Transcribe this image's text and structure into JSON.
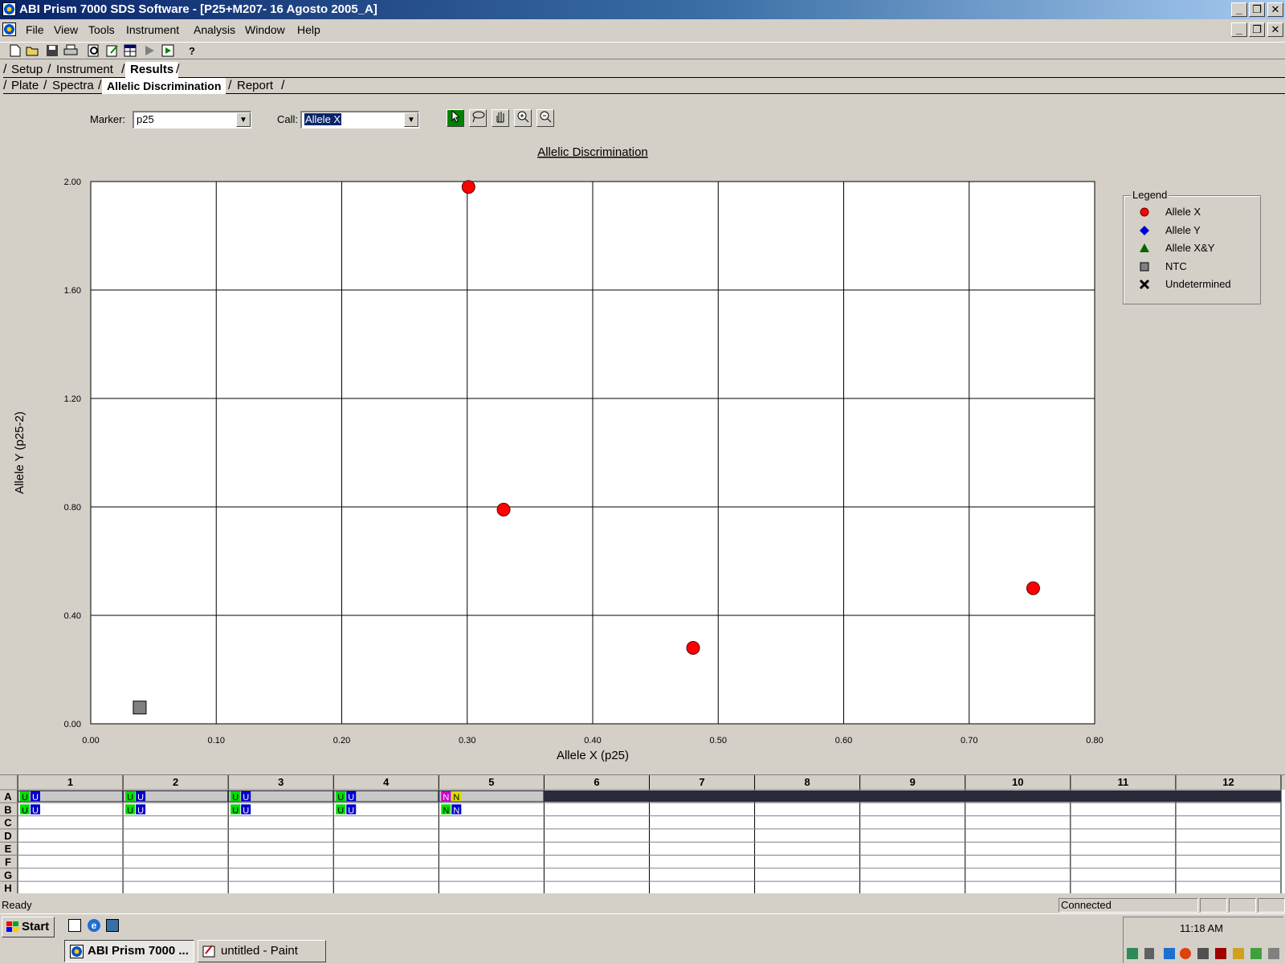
{
  "window": {
    "title": "ABI Prism 7000 SDS Software - [P25+M207- 16 Agosto 2005_A]",
    "minimize": "_",
    "restore": "❐",
    "close": "✕"
  },
  "menu": [
    "File",
    "View",
    "Tools",
    "Instrument",
    "Analysis",
    "Window",
    "Help"
  ],
  "toolbar": {
    "icons": [
      "new-icon",
      "open-icon",
      "save-icon",
      "print-icon",
      "preview-icon",
      "edit-icon",
      "table-icon",
      "play-icon",
      "run-icon",
      "help-icon"
    ]
  },
  "tabs": {
    "main": [
      "Setup",
      "Instrument",
      "Results"
    ],
    "main_active": "Results",
    "sub": [
      "Plate",
      "Spectra",
      "Allelic Discrimination",
      "Report"
    ],
    "sub_active": "Allelic Discrimination"
  },
  "controls": {
    "marker_label": "Marker:",
    "marker_value": "p25",
    "call_label": "Call:",
    "call_value": "Allele X",
    "tools": [
      "select-tool-icon",
      "lasso-tool-icon",
      "pan-tool-icon",
      "zoom-in-icon",
      "zoom-out-icon"
    ]
  },
  "chart_data": {
    "type": "scatter",
    "title": "Allelic Discrimination",
    "xlabel": "Allele X (p25)",
    "ylabel": "Allele Y (p25-2)",
    "xlim": [
      0.0,
      0.8
    ],
    "ylim": [
      0.0,
      2.0
    ],
    "xticks": [
      "0.00",
      "0.10",
      "0.20",
      "0.30",
      "0.40",
      "0.50",
      "0.60",
      "0.70",
      "0.80"
    ],
    "yticks": [
      "0.00",
      "0.40",
      "0.80",
      "1.20",
      "1.60",
      "2.00"
    ],
    "grid": true,
    "legend_position": "right",
    "series": [
      {
        "name": "Allele X",
        "marker": "circle",
        "color": "#ff0000",
        "points": [
          [
            0.301,
            1.98
          ],
          [
            0.329,
            0.79
          ],
          [
            0.48,
            0.28
          ],
          [
            0.751,
            0.5
          ]
        ]
      },
      {
        "name": "Allele Y",
        "marker": "diamond",
        "color": "#0000cc",
        "points": []
      },
      {
        "name": "Allele X&Y",
        "marker": "triangle",
        "color": "#006600",
        "points": []
      },
      {
        "name": "NTC",
        "marker": "square",
        "color": "#808080",
        "points": [
          [
            0.039,
            0.06
          ]
        ]
      },
      {
        "name": "Undetermined",
        "marker": "x",
        "color": "#000000",
        "points": []
      }
    ]
  },
  "legend": {
    "title": "Legend",
    "items": [
      {
        "label": "Allele X",
        "marker": "circle",
        "color": "#ff0000"
      },
      {
        "label": "Allele Y",
        "marker": "diamond",
        "color": "#0000cc"
      },
      {
        "label": "Allele X&Y",
        "marker": "triangle",
        "color": "#006600"
      },
      {
        "label": "NTC",
        "marker": "square",
        "color": "#808080"
      },
      {
        "label": "Undetermined",
        "marker": "x",
        "color": "#000000"
      }
    ]
  },
  "plate": {
    "columns": [
      "1",
      "2",
      "3",
      "4",
      "5",
      "6",
      "7",
      "8",
      "9",
      "10",
      "11",
      "12"
    ],
    "rows": [
      "A",
      "B",
      "C",
      "D",
      "E",
      "F",
      "G",
      "H"
    ],
    "wells": [
      {
        "row": "A",
        "col": 1,
        "tags": [
          {
            "t": "U",
            "c": "#00dd00"
          },
          {
            "t": "U",
            "c": "#0000cc"
          }
        ]
      },
      {
        "row": "A",
        "col": 2,
        "tags": [
          {
            "t": "U",
            "c": "#00dd00"
          },
          {
            "t": "U",
            "c": "#0000cc"
          }
        ]
      },
      {
        "row": "A",
        "col": 3,
        "tags": [
          {
            "t": "U",
            "c": "#00dd00"
          },
          {
            "t": "U",
            "c": "#0000cc"
          }
        ]
      },
      {
        "row": "A",
        "col": 4,
        "tags": [
          {
            "t": "U",
            "c": "#00dd00"
          },
          {
            "t": "U",
            "c": "#0000cc"
          }
        ]
      },
      {
        "row": "A",
        "col": 5,
        "tags": [
          {
            "t": "N",
            "c": "#cc00cc"
          },
          {
            "t": "N",
            "c": "#dddd00"
          }
        ]
      },
      {
        "row": "B",
        "col": 1,
        "tags": [
          {
            "t": "U",
            "c": "#00dd00"
          },
          {
            "t": "U",
            "c": "#0000cc"
          }
        ]
      },
      {
        "row": "B",
        "col": 2,
        "tags": [
          {
            "t": "U",
            "c": "#00dd00"
          },
          {
            "t": "U",
            "c": "#0000cc"
          }
        ]
      },
      {
        "row": "B",
        "col": 3,
        "tags": [
          {
            "t": "U",
            "c": "#00dd00"
          },
          {
            "t": "U",
            "c": "#0000cc"
          }
        ]
      },
      {
        "row": "B",
        "col": 4,
        "tags": [
          {
            "t": "U",
            "c": "#00dd00"
          },
          {
            "t": "U",
            "c": "#0000cc"
          }
        ]
      },
      {
        "row": "B",
        "col": 5,
        "tags": [
          {
            "t": "N",
            "c": "#00dd00"
          },
          {
            "t": "N",
            "c": "#0000cc"
          }
        ]
      }
    ],
    "selected_row": "A"
  },
  "status": {
    "left": "Ready",
    "right": "Connected"
  },
  "taskbar": {
    "start": "Start",
    "quicklaunch": [
      "desktop-icon",
      "ie-icon",
      "switch-icon"
    ],
    "tasks": [
      "ABI Prism 7000 ...",
      "untitled - Paint"
    ],
    "clock": "11:18 AM"
  }
}
